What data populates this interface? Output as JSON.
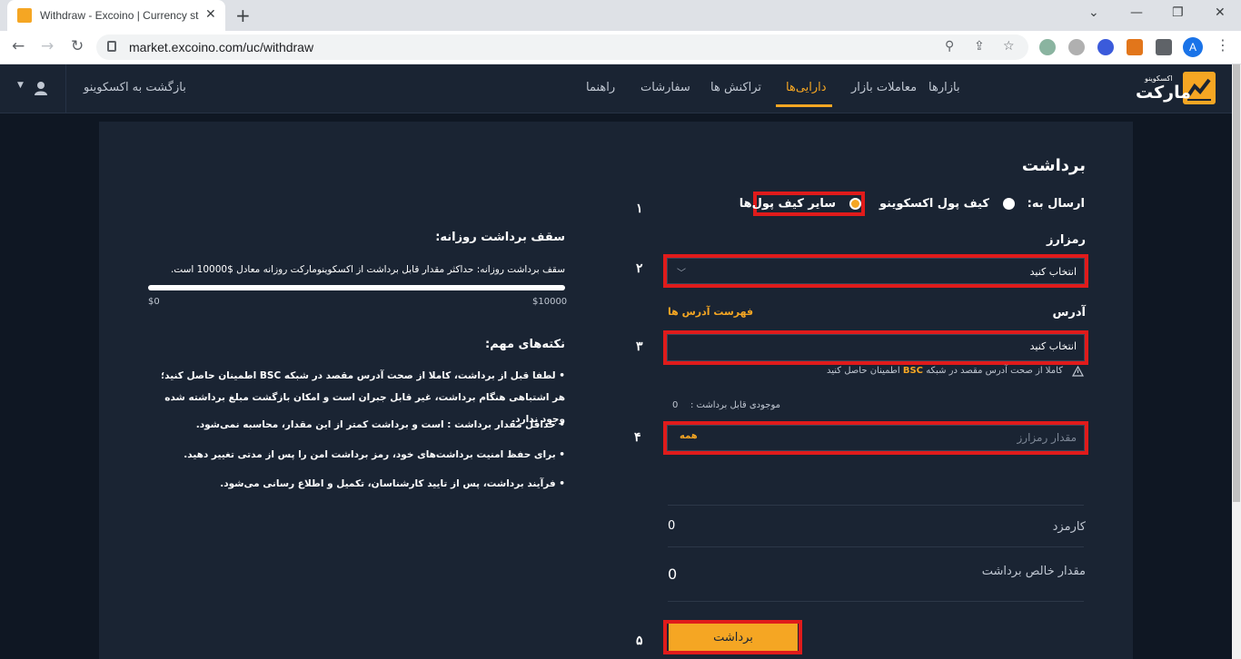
{
  "browser": {
    "tab_title": "Withdraw - Excoino | Currency st",
    "url": "market.excoino.com/uc/withdraw",
    "profile_initial": "A"
  },
  "header": {
    "logo_small": "اکسکوینو",
    "logo_big": "مارکت",
    "nav": [
      {
        "label": "بازارها"
      },
      {
        "label": "معاملات بازار"
      },
      {
        "label": "دارایی‌ها",
        "active": true
      },
      {
        "label": "تراکنش ها"
      },
      {
        "label": "سفارشات"
      },
      {
        "label": "راهنما"
      }
    ],
    "back_link": "بازگشت به اکسکوینو"
  },
  "form": {
    "title": "برداشت",
    "send_to_label": "ارسال به:",
    "option_excoino": "کیف پول اکسکوینو",
    "option_other": "سایر کیف پول‌ها",
    "option_selected": "option_other",
    "currency_label": "رمزارز",
    "currency_placeholder": "انتخاب کنید",
    "address_label": "آدرس",
    "address_list_link": "فهرست آدرس ها",
    "address_placeholder": "انتخاب کنید",
    "warning_pre": "کاملا از صحت آدرس مقصد در شبکه",
    "warning_network": "BSC",
    "warning_post": "اطمینان حاصل کنید",
    "balance_label": "موجودی قابل برداشت :",
    "balance_value": "0",
    "amount_placeholder": "مقدار رمزارز",
    "all_button": "همه",
    "fee_label": "کارمزد",
    "fee_value": "0",
    "net_label": "مقدار خالص برداشت",
    "net_value": "0",
    "submit_label": "برداشت"
  },
  "steps": [
    "۱",
    "۲",
    "۳",
    "۴",
    "۵"
  ],
  "limits": {
    "title": "سقف برداشت روزانه:",
    "description": "سقف برداشت روزانه: حداکثر مقدار قابل برداشت از اکسکوینومارکت روزانه معادل $10000 است.",
    "min_label": "$0",
    "max_label": "$10000",
    "used_fraction": 0
  },
  "notes": {
    "title": "نکته‌های مهم:",
    "items": [
      "• لطفا قبل از برداشت، کاملا از صحت آدرس مقصد در شبکه BSC اطمینان حاصل کنید؛ هر اشتباهی هنگام برداشت، غیر قابل جبران است و امکان بازگشت مبلغ برداشته شده وجود ندارد.",
      "• حداقل مقدار برداشت :  است و برداشت کمتر از این مقدار، محاسبه نمی‌شود.",
      "• برای حفظ امنیت برداشت‌های خود، رمز برداشت امن را پس از مدتی تغییر دهید.",
      "• فرآیند برداشت، پس از تایید کارشناسان، تکمیل و اطلاع رسانی می‌شود."
    ]
  }
}
